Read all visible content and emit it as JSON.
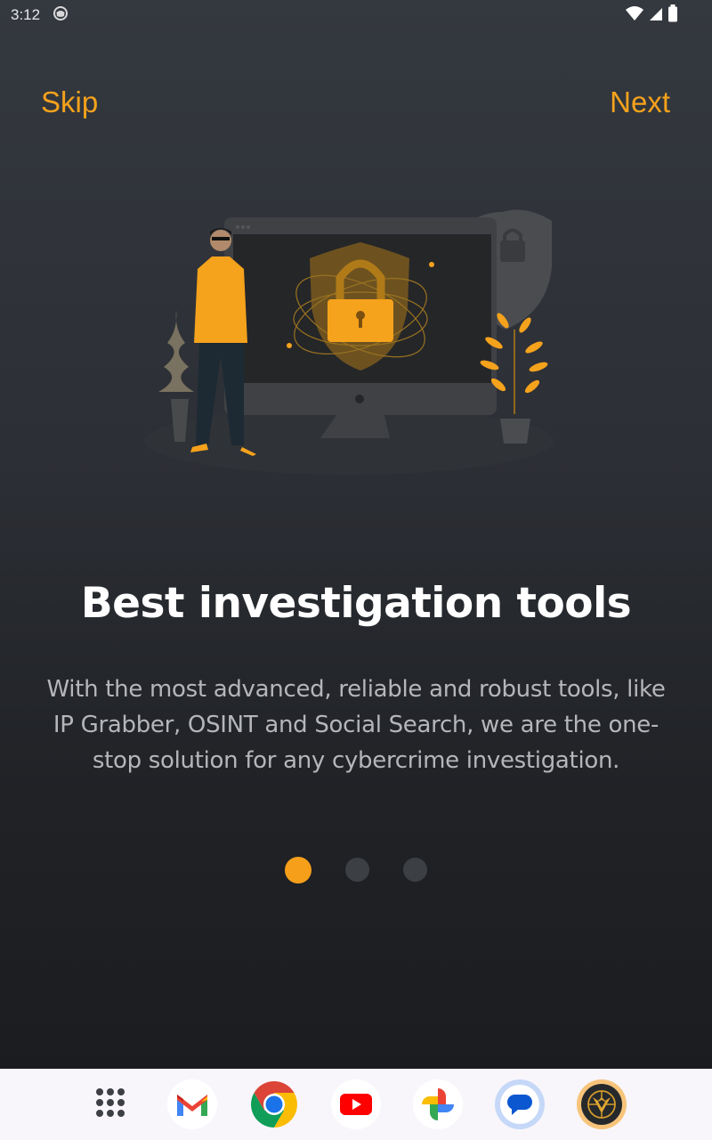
{
  "status_bar": {
    "time": "3:12",
    "icons": [
      "notification-icon",
      "wifi-icon",
      "signal-icon",
      "battery-icon"
    ]
  },
  "onboarding": {
    "skip_label": "Skip",
    "next_label": "Next",
    "illustration": "cybersecurity-illustration",
    "title": "Best investigation tools",
    "description": "With the most advanced, reliable and robust tools, like IP Grabber, OSINT and Social Search, we are the one-stop solution for any cybercrime investigation.",
    "pager": {
      "total_pages": 3,
      "current_page": 1
    }
  },
  "colors": {
    "accent": "#f5a21c",
    "background_top": "#34383f",
    "background_bottom": "#1a1b1f",
    "dot_inactive": "#3c4045",
    "dock": "#f8f6fb"
  },
  "dock": {
    "apps": [
      {
        "name": "App drawer",
        "icon": "app-drawer-icon"
      },
      {
        "name": "Gmail",
        "icon": "gmail-icon"
      },
      {
        "name": "Chrome",
        "icon": "chrome-icon"
      },
      {
        "name": "YouTube",
        "icon": "youtube-icon"
      },
      {
        "name": "Photos",
        "icon": "photos-icon"
      },
      {
        "name": "Messages",
        "icon": "messages-icon"
      },
      {
        "name": "Investigation app",
        "icon": "investigation-app-icon"
      }
    ]
  }
}
